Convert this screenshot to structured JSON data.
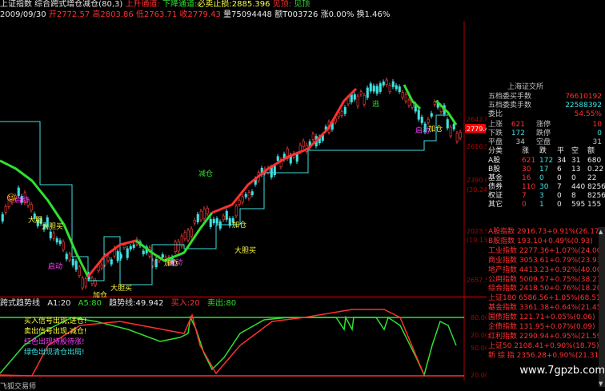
{
  "title_bar": {
    "parts": [
      {
        "text": "上证指数",
        "color": "#e8e8e8"
      },
      {
        "text": " 综合",
        "color": "#e8e8e8"
      },
      {
        "text": "跨式增仓减仓(80,3)",
        "color": "#e8e8e8"
      },
      {
        "text": " 上升通道:",
        "color": "#ff3030"
      },
      {
        "text": " 下降通道:",
        "color": "#30e030"
      },
      {
        "text": "必卖止损:2885.396",
        "color": "#ffff40"
      },
      {
        "text": " 见顶:",
        "color": "#ff3030"
      },
      {
        "text": " 见顶",
        "color": "#30e030"
      }
    ]
  },
  "quote_bar": {
    "date": "2009/09/30",
    "open": "开2772.57",
    "high": "高2803.86",
    "low": "低2763.71",
    "close": "收2779.43",
    "volume": "量75094448",
    "amount": "额T003726",
    "change": "涨0.00%",
    "turnover": "换1.46%"
  },
  "main_chart": {
    "labels": [
      {
        "text": "启动",
        "color": "#ff40ff"
      },
      {
        "text": "启动",
        "color": "#ff40ff"
      },
      {
        "text": "启动",
        "color": "#ff40ff"
      },
      {
        "text": "启动",
        "color": "#ff40ff"
      },
      {
        "text": "加仓",
        "color": "#ffff40"
      },
      {
        "text": "加仓",
        "color": "#ffff40"
      },
      {
        "text": "加仓",
        "color": "#ffff40"
      },
      {
        "text": "加仓",
        "color": "#ffff40"
      },
      {
        "text": "减仓",
        "color": "#30e030"
      },
      {
        "text": "逃",
        "color": "#30e030"
      },
      {
        "text": "大胆",
        "color": "#ffff40"
      },
      {
        "text": "大胆买",
        "color": "#ffff40"
      },
      {
        "text": "大胆买",
        "color": "#ffff40"
      },
      {
        "text": "大胆买",
        "color": "#ffff40"
      }
    ],
    "price_tag": "2779.4",
    "y_ticks": [
      "2642.8",
      "2616.5",
      "2390.0",
      "(20.24)",
      "2023.5",
      "(19.13)",
      "2657.5"
    ]
  },
  "indicator": {
    "header_name": "跨式趋势线",
    "a1": "A1:20",
    "a5": "A5:80",
    "trend": "趋势线:49.942",
    "buy": "买入:20",
    "sell": "卖出:80",
    "legend": [
      {
        "text": "买入信号出现,进仓!",
        "color": "#ffff40"
      },
      {
        "text": "卖出信号出现,减仓!",
        "color": "#ffff40"
      },
      {
        "text": "红色出现持股待涨!",
        "color": "#ff40ff"
      },
      {
        "text": "绿色出现清仓出局!",
        "color": "#40e0e0"
      }
    ],
    "y_ticks": [
      "80.00",
      "20.00",
      "50.00",
      "20.00"
    ]
  },
  "right_panel": {
    "exchange": "上海证交所",
    "order_rows": [
      {
        "label": "五档委买手数",
        "value": "76610192"
      },
      {
        "label": "五档委卖手数",
        "value": "22588392"
      },
      {
        "label": "委比",
        "value": "54.55%"
      }
    ],
    "stats": [
      {
        "a": "上涨",
        "b": "621",
        "c": "涨停",
        "d": "10"
      },
      {
        "a": "下跌",
        "b": "172",
        "c": "跌停",
        "d": "0"
      },
      {
        "a": "平盘",
        "b": "34",
        "c": "空盘",
        "d": "31"
      }
    ],
    "cat_header": [
      "分类",
      "涨",
      "跌",
      "平",
      "空",
      "额"
    ],
    "categories": [
      {
        "name": "A股",
        "up": "621",
        "down": "172",
        "flat": "34",
        "empty": "31",
        "amt": "680"
      },
      {
        "name": "B股",
        "up": "30",
        "down": "17",
        "flat": "6",
        "empty": "13",
        "amt": "0.22"
      },
      {
        "name": "基金",
        "up": "16",
        "down": "0",
        "flat": "0",
        "empty": "0",
        "amt": "22"
      },
      {
        "name": "债券",
        "up": "110",
        "down": "30",
        "flat": "7",
        "empty": "440",
        "amt": "8256"
      },
      {
        "name": "权证",
        "up": "7",
        "down": "3",
        "flat": "0",
        "empty": "8",
        "amt": "8256"
      },
      {
        "name": "其它",
        "up": "0",
        "down": "1",
        "flat": "0",
        "empty": "595",
        "amt": "155"
      }
    ],
    "indices": [
      "A股指数 2916.73+0.91%(26.17)",
      "B股指数 193.10+0.49%(0.93)",
      "工业指数 2277.36+1.07%(24.00)",
      "商业指数 3053.61+0.79%(23.93)",
      "地产指数 4413.23+0.92%(40.00)",
      "公用指数 5009.57+0.75%(38.27)",
      "综合指数 2418.50+0.76%(18.20)",
      "上证180 6586.56+1.05%(68.51)",
      "基金指数 3361.38+0.64%(21.45)",
      "国债指数 121.71+0.05%(0.06)",
      "企债指数 131.95+0.07%(0.09)",
      "红利指数 2290.94+0.95%(21.59)",
      "上证50 2108.41+0.90%(18.75)",
      "新 综 指 2356.28+0.90%(21.31)"
    ]
  },
  "watermark": "www.7gpzb.com",
  "bottom_label": "飞狐交易师",
  "colors": {
    "red": "#ff3030",
    "green": "#30e030",
    "yellow": "#ffff40",
    "magenta": "#ff40ff",
    "cyan": "#40e0e0",
    "axis_red": "#b00000"
  }
}
